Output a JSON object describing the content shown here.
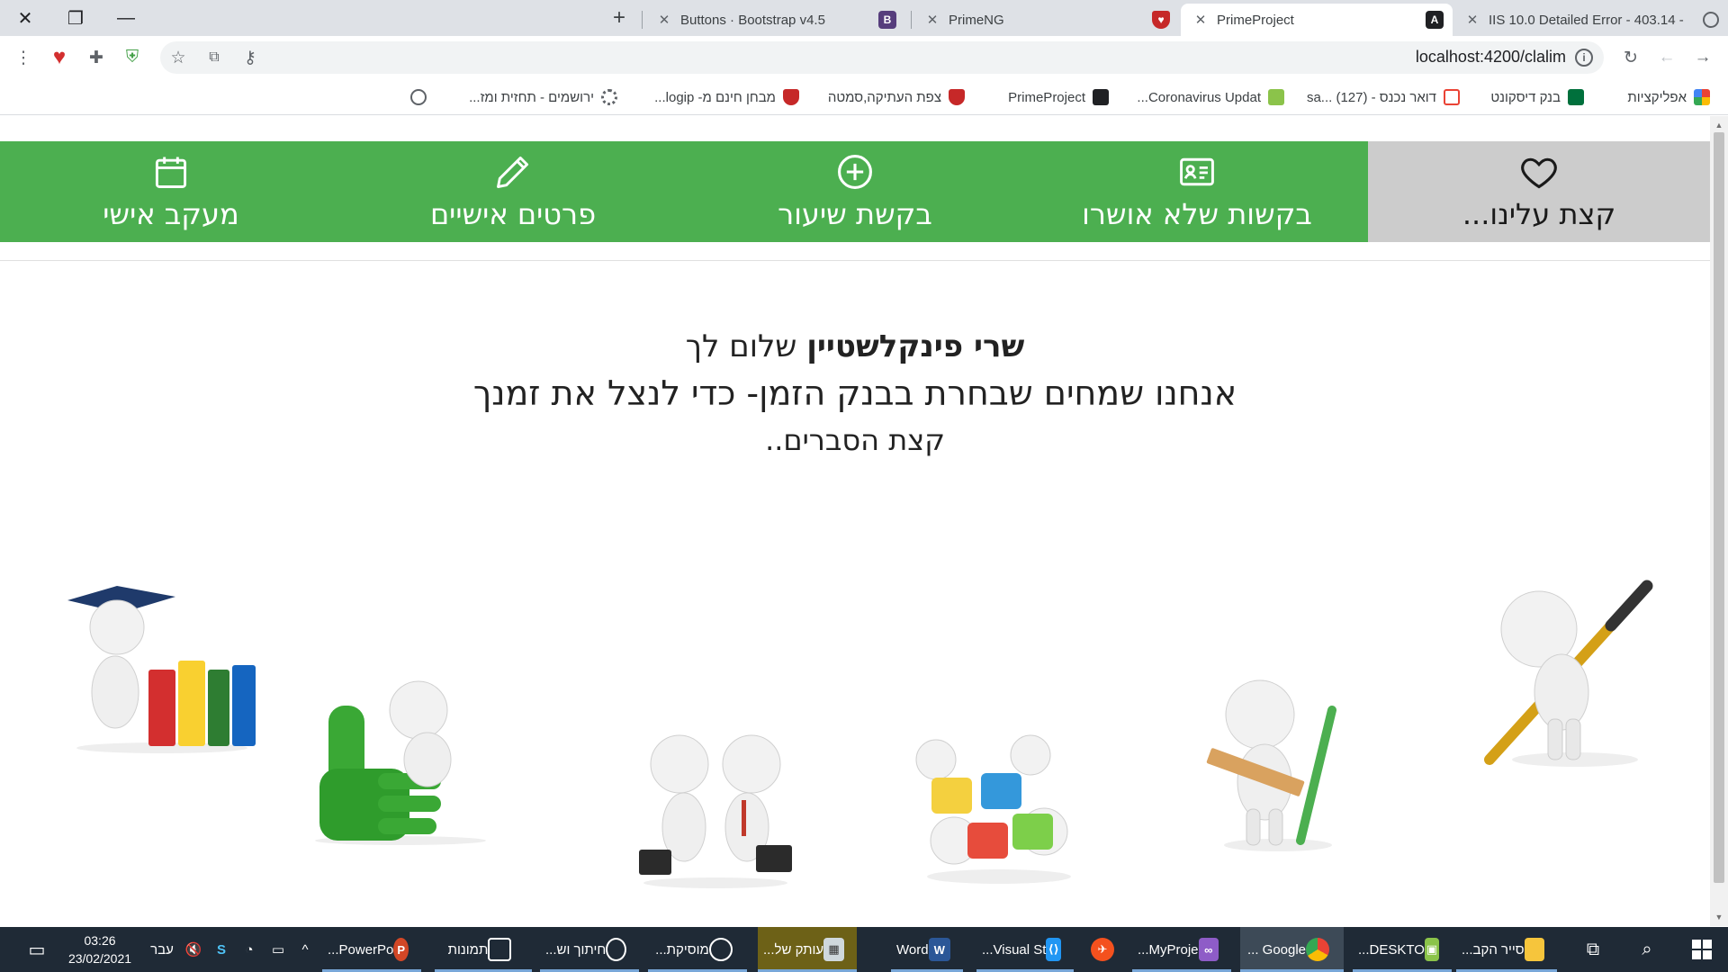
{
  "browser": {
    "tabs": [
      {
        "title": "IIS 10.0 Detailed Error - 403.14 -",
        "active": false,
        "favicon": "globe-icon"
      },
      {
        "title": "PrimeProject",
        "active": true,
        "favicon": "angular-icon"
      },
      {
        "title": "PrimeNG",
        "active": false,
        "favicon": "shield-icon"
      },
      {
        "title": "Buttons · Bootstrap v4.5",
        "active": false,
        "favicon": "bootstrap-icon"
      }
    ],
    "new_tab_label": "+",
    "url": "localhost:4200/clalim",
    "bookmarks": [
      {
        "label": "אפליקציות",
        "icon": "apps-grid-icon",
        "color": "#ea4335"
      },
      {
        "label": "בנק דיסקונט",
        "icon": "bank-icon",
        "color": "#00703c"
      },
      {
        "label": "דואר נכנס - sa... (127)",
        "icon": "gmail-icon",
        "color": "#ea4335"
      },
      {
        "label": "Coronavirus Updat...",
        "icon": "w-icon",
        "color": "#8bc34a"
      },
      {
        "label": "PrimeProject",
        "icon": "angular-icon",
        "color": "#202124"
      },
      {
        "label": "צפת העתיקה,סמטה",
        "icon": "shield-icon",
        "color": "#c62828"
      },
      {
        "label": "מבחן חינם מ- logip...",
        "icon": "shield-icon",
        "color": "#c62828"
      },
      {
        "label": "ירושמים - תחזית ומז...",
        "icon": "gear-icon",
        "color": "#5f6368"
      },
      {
        "label": "",
        "icon": "globe-icon",
        "color": "#5f6368"
      }
    ]
  },
  "nav": {
    "items": [
      {
        "label": "קצת עלינו...",
        "icon": "heart-icon",
        "active": true
      },
      {
        "label": "בקשות שלא אושרו",
        "icon": "id-card-icon",
        "active": false
      },
      {
        "label": "בקשת שיעור",
        "icon": "plus-circle-icon",
        "active": false
      },
      {
        "label": "פרטים אישיים",
        "icon": "pencil-icon",
        "active": false
      },
      {
        "label": "מעקב אישי",
        "icon": "calendar-icon",
        "active": false
      }
    ]
  },
  "greeting": {
    "name": "שרי פינקלשטיין",
    "hello": "שלום לך",
    "line2": "אנחנו שמחים שבחרת בבנק הזמן- כדי לנצל את זמנך",
    "line3": "קצת הסברים.."
  },
  "figures": [
    {
      "name": "figure-with-pen-image"
    },
    {
      "name": "figure-with-pencil-ruler-image"
    },
    {
      "name": "figures-puzzle-image"
    },
    {
      "name": "figures-handshake-image"
    },
    {
      "name": "figure-thumbs-up-image"
    },
    {
      "name": "figure-graduate-books-image"
    }
  ],
  "taskbar": {
    "apps": [
      {
        "label": "סייר הקב...",
        "color": "#f6c53c"
      },
      {
        "label": "DESKTO...",
        "color": "#8bc34a"
      },
      {
        "label": "Google ...",
        "color": "#e53935"
      },
      {
        "label": "MyProje...",
        "color": "#8e5cc7"
      },
      {
        "label": "",
        "color": "#f4511e"
      },
      {
        "label": "Visual St...",
        "color": "#2196f3"
      },
      {
        "label": "Word",
        "color": "#2b5797"
      },
      {
        "label": "עותק של...",
        "color": "#cfd8dc"
      },
      {
        "label": "מוסיקת...",
        "color": "#ffffff"
      },
      {
        "label": "חיתוך וש...",
        "color": "#ffffff"
      },
      {
        "label": "תמונות",
        "color": "#ffffff"
      },
      {
        "label": "PowerPo...",
        "color": "#d24726"
      }
    ],
    "language": "עבר",
    "time": "03:26",
    "date": "23/02/2021"
  },
  "colors": {
    "nav_green": "#4caf50",
    "nav_active": "#cccccc",
    "taskbar": "#1f2a36"
  }
}
